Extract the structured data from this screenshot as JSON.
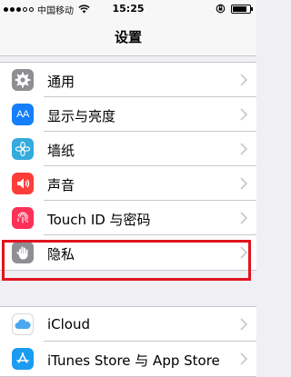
{
  "status_bar": {
    "carrier": "中国移动",
    "time": "15:25",
    "battery_level": 0.85
  },
  "nav": {
    "title": "设置"
  },
  "groups": [
    {
      "items": [
        {
          "label": "通用",
          "icon": "gear-icon",
          "icon_color": "#8e8e93"
        },
        {
          "label": "显示与亮度",
          "icon": "text-size-icon",
          "icon_color": "#147efb"
        },
        {
          "label": "墙纸",
          "icon": "flower-icon",
          "icon_color": "#35aadc"
        },
        {
          "label": "声音",
          "icon": "speaker-icon",
          "icon_color": "#fc3d39"
        },
        {
          "label": "Touch ID 与密码",
          "icon": "fingerprint-icon",
          "icon_color": "#fc3158"
        },
        {
          "label": "隐私",
          "icon": "hand-icon",
          "icon_color": "#8e8e93"
        }
      ]
    },
    {
      "items": [
        {
          "label": "iCloud",
          "icon": "cloud-icon",
          "icon_color": "#ffffff"
        },
        {
          "label": "iTunes Store 与 App Store",
          "icon": "app-store-icon",
          "icon_color": "#1a9cf0"
        }
      ]
    }
  ],
  "highlight_color": "#e0141e",
  "icons": {
    "text_size_glyph": "AA"
  }
}
